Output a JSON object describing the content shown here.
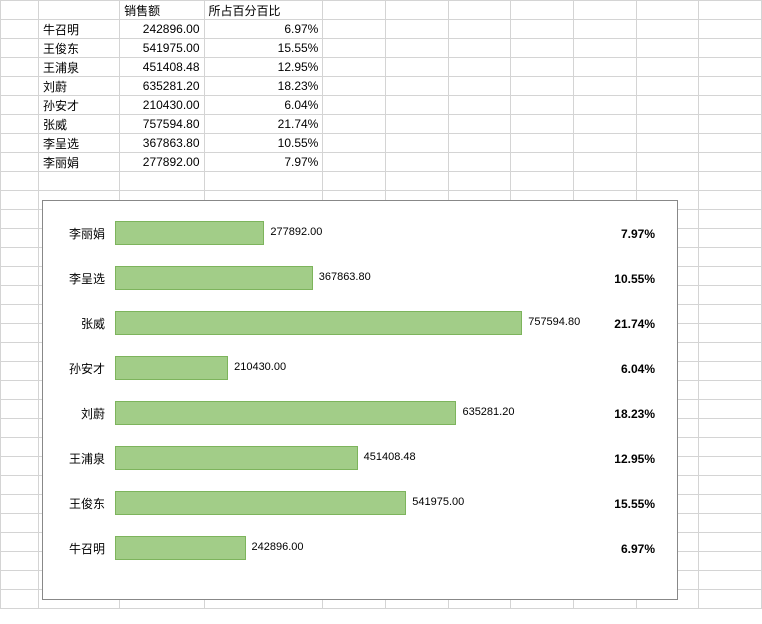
{
  "table": {
    "headers": {
      "sales": "销售额",
      "pct": "所占百分百比"
    },
    "rows": [
      {
        "name": "牛召明",
        "sales": "242896.00",
        "pct": "6.97%"
      },
      {
        "name": "王俊东",
        "sales": "541975.00",
        "pct": "15.55%"
      },
      {
        "name": "王浦泉",
        "sales": "451408.48",
        "pct": "12.95%"
      },
      {
        "name": "刘蔚",
        "sales": "635281.20",
        "pct": "18.23%"
      },
      {
        "name": "孙安才",
        "sales": "210430.00",
        "pct": "6.04%"
      },
      {
        "name": "张威",
        "sales": "757594.80",
        "pct": "21.74%"
      },
      {
        "name": "李呈选",
        "sales": "367863.80",
        "pct": "10.55%"
      },
      {
        "name": "李丽娟",
        "sales": "277892.00",
        "pct": "7.97%"
      }
    ]
  },
  "chart_data": {
    "type": "bar",
    "categories": [
      "李丽娟",
      "李呈选",
      "张威",
      "孙安才",
      "刘蔚",
      "王浦泉",
      "王俊东",
      "牛召明"
    ],
    "values": [
      277892.0,
      367863.8,
      757594.8,
      210430.0,
      635281.2,
      451408.48,
      541975.0,
      242896.0
    ],
    "labels": [
      "277892.00",
      "367863.80",
      "757594.80",
      "210430.00",
      "635281.20",
      "451408.48",
      "541975.00",
      "242896.00"
    ],
    "pct": [
      "7.97%",
      "10.55%",
      "21.74%",
      "6.04%",
      "18.23%",
      "12.95%",
      "15.55%",
      "6.97%"
    ],
    "title": "",
    "xlabel": "",
    "ylabel": "",
    "xlim": [
      0,
      800000
    ]
  }
}
